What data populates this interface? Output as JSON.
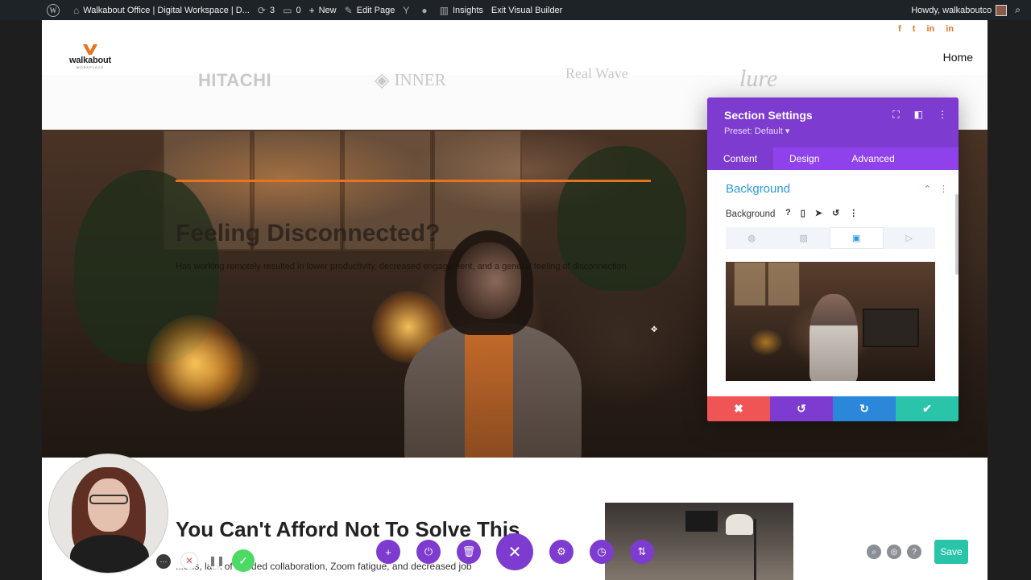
{
  "admin_bar": {
    "site_title": "Walkabout Office | Digital Workspace | D...",
    "updates_count": "3",
    "comments_count": "0",
    "new_label": "New",
    "edit_page_label": "Edit Page",
    "insights_label": "Insights",
    "exit_builder_label": "Exit Visual Builder",
    "greeting": "Howdy, walkaboutco"
  },
  "header": {
    "logo_text": "walkabout",
    "logo_sub": "WORKPLACE",
    "nav_home": "Home",
    "social_icons": [
      "facebook-icon",
      "twitter-icon",
      "linkedin-icon",
      "linkedin-icon"
    ]
  },
  "client_logos": [
    "HITACHI",
    "INNER",
    "Real Wave",
    "lure"
  ],
  "hero": {
    "title": "Feeling Disconnected?",
    "subtitle": "Has working remotely resulted in lower productivity, decreased engagement, and a general feeling of disconnection",
    "accent_color": "#e8731e"
  },
  "bottom": {
    "title": "You Can't Afford Not To Solve This",
    "text": "...ons, lack of needed collaboration, Zoom fatigue, and decreased job"
  },
  "settings_panel": {
    "title": "Section Settings",
    "preset": "Preset: Default ▾",
    "tabs": [
      "Content",
      "Design",
      "Advanced"
    ],
    "active_tab": "Content",
    "toggle_title": "Background",
    "field_label": "Background",
    "bg_types": [
      "color",
      "gradient",
      "image",
      "video"
    ],
    "active_bg_type": "image",
    "footer_colors": {
      "discard": "#ef5555",
      "undo": "#7e3bd0",
      "redo": "#2b87da",
      "save": "#29c4a9"
    }
  },
  "builder_bar": {
    "save_label": "Save",
    "buttons": [
      "add-icon",
      "power-icon",
      "trash-icon",
      "close-icon",
      "gear-icon",
      "history-icon",
      "sort-icon"
    ]
  },
  "colors": {
    "divi_purple": "#7e3bd0",
    "divi_tab_purple": "#8f42ec",
    "admin_bar": "#1d2327",
    "link_blue": "#2e9ae0"
  }
}
